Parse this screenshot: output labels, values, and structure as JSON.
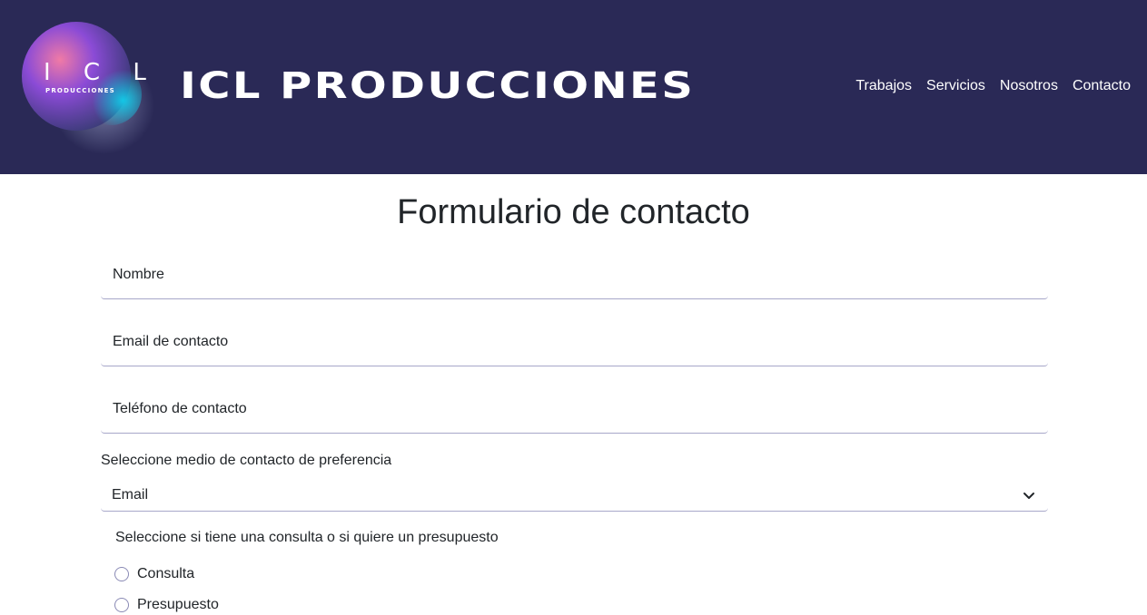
{
  "header": {
    "logo": {
      "top_text": "I C L",
      "sub_text": "PRODUCCIONES",
      "icon": "gradient-blob-logo"
    },
    "brand_title": "ICL PRODUCCIONES",
    "nav": [
      {
        "label": "Trabajos"
      },
      {
        "label": "Servicios"
      },
      {
        "label": "Nosotros"
      },
      {
        "label": "Contacto"
      }
    ],
    "background_color": "#2a2956"
  },
  "form": {
    "title": "Formulario de contacto",
    "fields": [
      {
        "placeholder": "Nombre"
      },
      {
        "placeholder": "Email de contacto"
      },
      {
        "placeholder": "Teléfono de contacto"
      }
    ],
    "select": {
      "label": "Seleccione medio de contacto de preferencia",
      "value": "Email",
      "icon": "chevron-down-icon"
    },
    "radio_group": {
      "label": "Seleccione si tiene una consulta o si quiere un presupuesto",
      "options": [
        {
          "label": "Consulta",
          "checked": false
        },
        {
          "label": "Presupuesto",
          "checked": false
        }
      ]
    }
  }
}
